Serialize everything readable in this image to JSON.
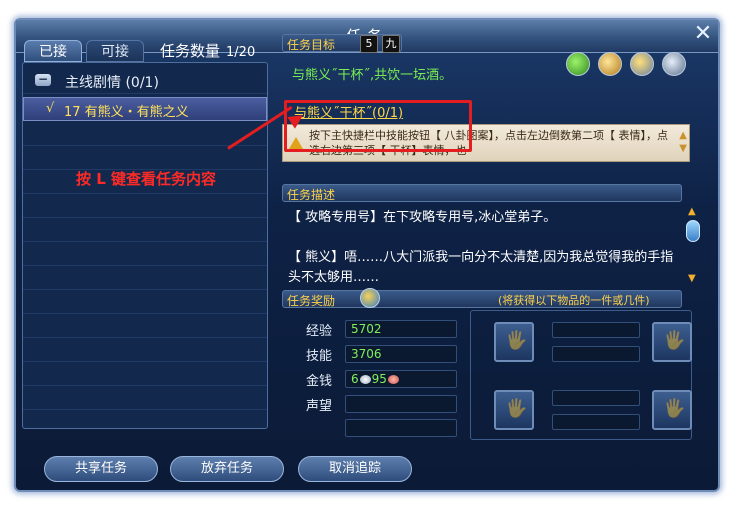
{
  "window": {
    "title": "任务"
  },
  "tabs": [
    {
      "label": "已接"
    },
    {
      "label": "可接"
    }
  ],
  "task_count": {
    "label": "任务数量",
    "value": "1/20"
  },
  "task_list": {
    "category": {
      "label": "主线剧情",
      "count": "(0/1)"
    },
    "selected": {
      "check": "√",
      "label": "17 有熊义・有熊之义"
    }
  },
  "goal": {
    "header": "任务目标",
    "difficulty_badges": [
      "5",
      "九"
    ],
    "line1": "与熊义˝干杯˝,共饮一坛酒。",
    "line2": "与熊义˝干杯˝(0/1)",
    "hint": "按下主快捷栏中技能按钮【 八卦图案】，点击左边倒数第二项【 表情】，点选右边第三项【 干杯】表情，也"
  },
  "annotation": "按 L 键查看任务内容",
  "description": {
    "header": "任务描述",
    "lines": [
      "【 攻略专用号】在下攻略专用号,冰心堂弟子。",
      "",
      "【 熊义】唔……八大门派我一向分不太清楚,因为我总觉得我的手指头不太够用……"
    ]
  },
  "rewards": {
    "header": "任务奖励",
    "note": "(将获得以下物品的一件或几件)",
    "exp": {
      "label": "经验",
      "value": "5702"
    },
    "skill": {
      "label": "技能",
      "value": "3706"
    },
    "money": {
      "label": "金钱",
      "silver": "6",
      "copper": "95"
    },
    "reputation": {
      "label": "声望",
      "value": ""
    }
  },
  "buttons": {
    "share": "共享任务",
    "abandon": "放弃任务",
    "cancel_track": "取消追踪"
  },
  "colors": {
    "accent": "#ffd24a",
    "goal_green": "#79ef52",
    "selected_yellow": "#ffe25a",
    "annotation_red": "#e41e20"
  }
}
